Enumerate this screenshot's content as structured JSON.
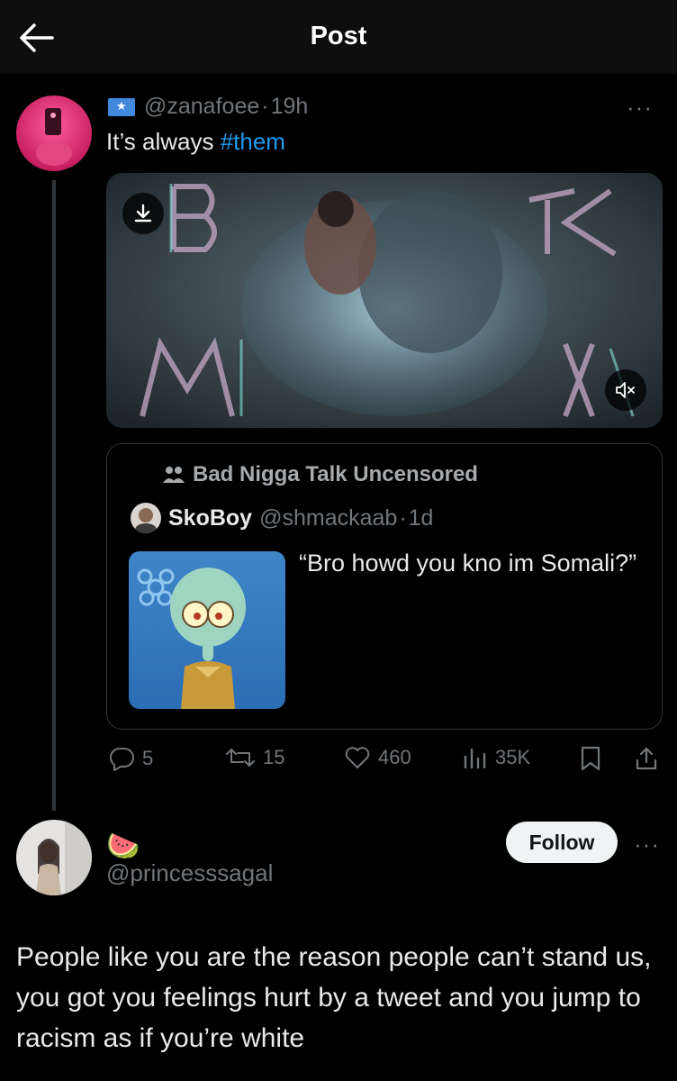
{
  "header": {
    "title": "Post"
  },
  "post": {
    "handle": "@zanafoee",
    "sep": "·",
    "time": "19h",
    "text": "It’s always ",
    "hashtag": "#them",
    "more": "···",
    "media_overlay_text": "BLACK LIVES MATTER"
  },
  "quote": {
    "community": "Bad Nigga Talk Uncensored",
    "name": "SkoBoy",
    "handle": "@shmackaab",
    "sep": "·",
    "time": "1d",
    "text": "“Bro howd you kno im Somali?”"
  },
  "actions": {
    "replies": "5",
    "reposts": "15",
    "likes": "460",
    "views": "35K"
  },
  "reply": {
    "emoji": "🍉",
    "handle": "@princesssagal",
    "follow": "Follow",
    "more": "···",
    "text": "People like you are the reason people can’t stand us, you got you feelings hurt by a tweet and you jump to racism as if you’re white"
  },
  "colors": {
    "accent": "#1d9bf0",
    "muted": "#71767b",
    "text": "#e7e9ea"
  }
}
